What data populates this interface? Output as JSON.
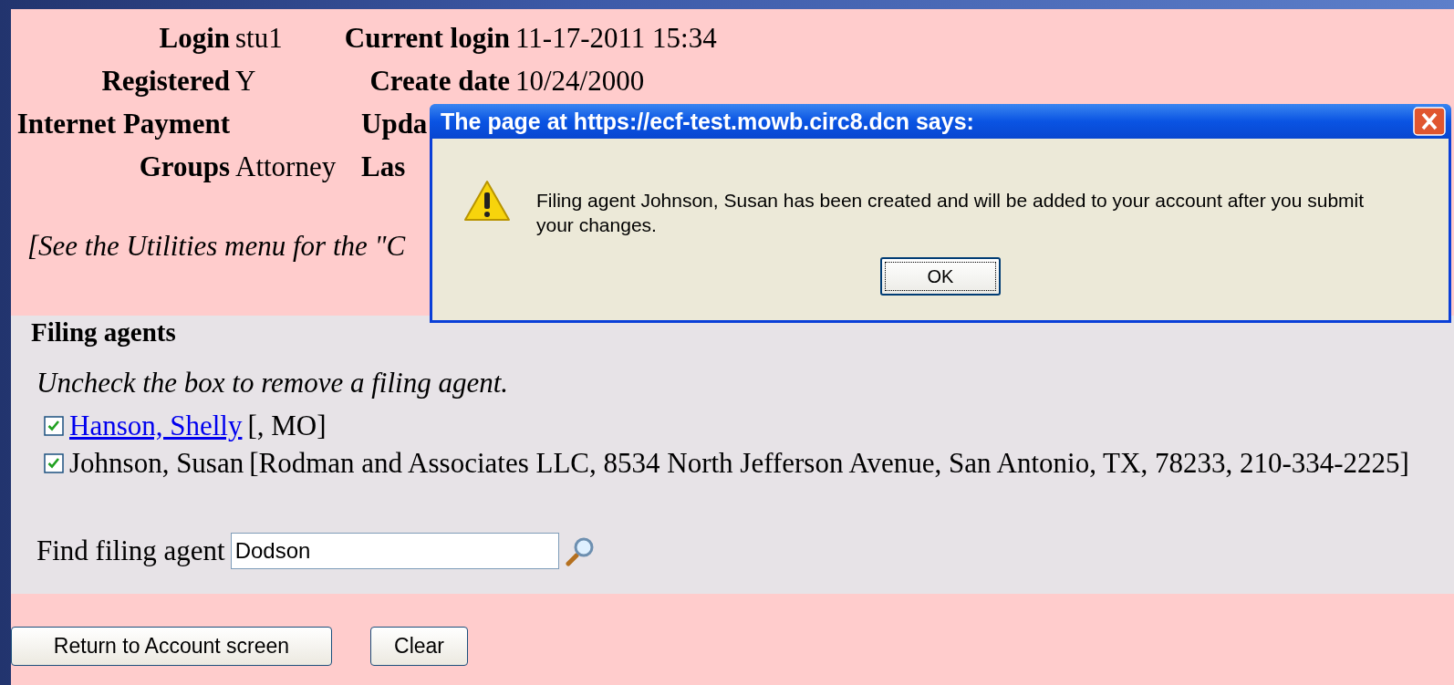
{
  "account_rows": [
    {
      "label": "Login",
      "value": "stu1",
      "label_2": "Current login",
      "value_2": "11-17-2011 15:34"
    },
    {
      "label": "Registered",
      "value": "Y",
      "label_2": "Create date",
      "value_2": "10/24/2000"
    },
    {
      "label": "Internet Payment",
      "label_2": "Upda"
    },
    {
      "label": "Groups",
      "value": "Attorney",
      "label_2": "Las"
    }
  ],
  "note": "[See the Utilities menu for the \"C",
  "filing_agents": {
    "heading": "Filing agents",
    "hint": "Uncheck the box to remove a filing agent.",
    "items": [
      {
        "kind": "link",
        "name": "Hanson, Shelly",
        "detail": "[, MO]",
        "checked": true
      },
      {
        "kind": "text",
        "name": "Johnson, Susan",
        "detail": "[Rodman and Associates LLC, 8534 North Jefferson Avenue, San Antonio, TX, 78233, 210-334-2225]",
        "checked": true
      }
    ],
    "search": {
      "label": "Find filing agent",
      "value": "Dodson"
    }
  },
  "buttons": [
    "Return to Account screen",
    "Clear"
  ],
  "dialog": {
    "title": "The page at https://ecf-test.mowb.circ8.dcn says:",
    "message": "Filing agent Johnson, Susan has been created and will be added to your account after you submit your changes.",
    "button": "OK"
  }
}
